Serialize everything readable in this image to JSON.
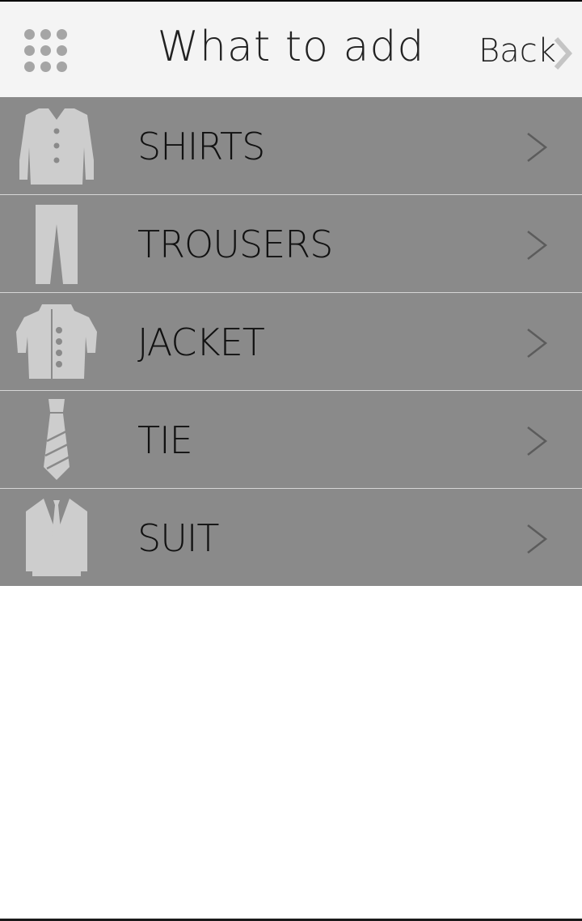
{
  "header": {
    "title": "What to add",
    "back_label": "Back",
    "menu_icon": "grid-menu-icon",
    "back_icon": "chevron-right-icon"
  },
  "categories": [
    {
      "label": "SHIRTS",
      "icon": "shirt-icon"
    },
    {
      "label": "TROUSERS",
      "icon": "trousers-icon"
    },
    {
      "label": "JACKET",
      "icon": "jacket-icon"
    },
    {
      "label": "TIE",
      "icon": "tie-icon"
    },
    {
      "label": "SUIT",
      "icon": "suit-icon"
    }
  ],
  "colors": {
    "header_bg": "#f4f4f4",
    "row_bg": "#8a8a8a",
    "icon_fill": "#cdcdcd",
    "text": "#111111"
  }
}
